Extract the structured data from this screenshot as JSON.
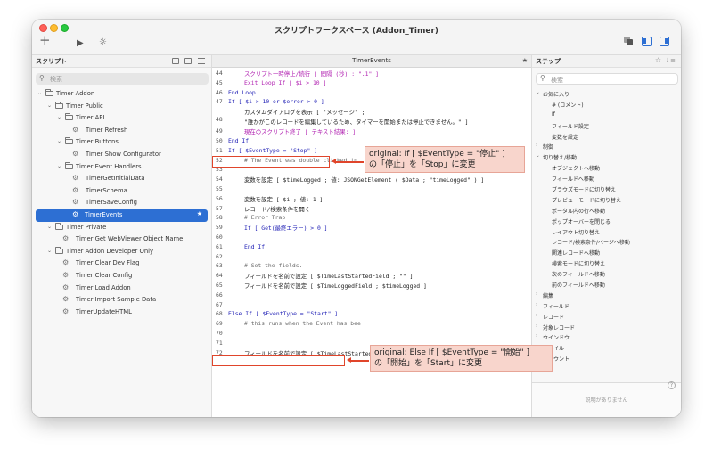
{
  "window": {
    "title": "スクリプトワークスペース (Addon_Timer)"
  },
  "toolbar": {
    "new_icon": "+",
    "run_icon": "▶",
    "debug_icon": "☼"
  },
  "left_panel": {
    "title": "スクリプト",
    "search_placeholder": "検索",
    "tree": [
      {
        "label": "Timer Addon",
        "type": "folder",
        "level": 0
      },
      {
        "label": "Timer Public",
        "type": "folder",
        "level": 1
      },
      {
        "label": "Timer API",
        "type": "folder",
        "level": 2
      },
      {
        "label": "Timer Refresh",
        "type": "script",
        "level": 3
      },
      {
        "label": "Timer Buttons",
        "type": "folder",
        "level": 2
      },
      {
        "label": "Timer Show Configurator",
        "type": "script",
        "level": 3
      },
      {
        "label": "Timer Event Handlers",
        "type": "folder",
        "level": 2
      },
      {
        "label": "TimerGetInitialData",
        "type": "script",
        "level": 3
      },
      {
        "label": "TimerSchema",
        "type": "script",
        "level": 3
      },
      {
        "label": "TimerSaveConfig",
        "type": "script",
        "level": 3
      },
      {
        "label": "TimerEvents",
        "type": "script",
        "level": 3,
        "selected": true
      },
      {
        "label": "Timer Private",
        "type": "folder",
        "level": 1
      },
      {
        "label": "Timer Get WebViewer Object Name",
        "type": "script",
        "level": 2
      },
      {
        "label": "Timer Addon Developer Only",
        "type": "folder",
        "level": 1
      },
      {
        "label": "Timer Clear Dev Flag",
        "type": "script",
        "level": 2
      },
      {
        "label": "Timer Clear Config",
        "type": "script",
        "level": 2
      },
      {
        "label": "Timer Load Addon",
        "type": "script",
        "level": 2
      },
      {
        "label": "Timer Import Sample Data",
        "type": "script",
        "level": 2
      },
      {
        "label": "TimerUpdateHTML",
        "type": "script",
        "level": 2
      }
    ]
  },
  "editor": {
    "tab_title": "TimerEvents",
    "lines": [
      {
        "n": "44",
        "indent": 2,
        "cls": "m",
        "text": "スクリプト一時停止/続行 [ 間隔 (秒) : \".1\" ]"
      },
      {
        "n": "45",
        "indent": 2,
        "cls": "m",
        "text": "Exit Loop If [ $i > 10 ]"
      },
      {
        "n": "46",
        "indent": 0,
        "cls": "k",
        "text": "End Loop"
      },
      {
        "n": "47",
        "indent": 0,
        "cls": "k",
        "text": "If [ $i > 10 or  $error > 0 ]"
      },
      {
        "n": "48",
        "indent": 2,
        "cls": "t",
        "text": "カスタムダイアログを表示 [ \"メッセージ\" ;",
        "text2": "\"誰かがこのレコードを編集しているため、タイマーを開始または停止できません。\" ]"
      },
      {
        "n": "49",
        "indent": 2,
        "cls": "m",
        "text": "現在のスクリプト終了 [ テキスト結果: ]"
      },
      {
        "n": "50",
        "indent": 0,
        "cls": "k",
        "text": "End If"
      },
      {
        "n": "51",
        "indent": 0,
        "cls": "k",
        "text": "If [ $EventType = \"Stop\" ]"
      },
      {
        "n": "52",
        "indent": 2,
        "cls": "c",
        "text": "# The Event was double clicked in"
      },
      {
        "n": "53",
        "indent": 0,
        "cls": "t",
        "text": ""
      },
      {
        "n": "54",
        "indent": 2,
        "cls": "t",
        "text": "変数を設定 [ $timeLogged ; 値: JSONGetElement ( $Data ; \"timeLogged\" ) ]"
      },
      {
        "n": "55",
        "indent": 0,
        "cls": "t",
        "text": ""
      },
      {
        "n": "56",
        "indent": 2,
        "cls": "t",
        "text": "変数を設定 [ $i ; 値: 1 ]"
      },
      {
        "n": "57",
        "indent": 2,
        "cls": "t",
        "text": "レコード/検索条件を開く"
      },
      {
        "n": "58",
        "indent": 2,
        "cls": "c",
        "text": "# Error Trap"
      },
      {
        "n": "59",
        "indent": 2,
        "cls": "k",
        "text": "If [ Get(最終エラー) > 0 ]"
      },
      {
        "n": "60",
        "indent": 0,
        "cls": "t",
        "text": ""
      },
      {
        "n": "61",
        "indent": 2,
        "cls": "k",
        "text": "End If"
      },
      {
        "n": "62",
        "indent": 0,
        "cls": "t",
        "text": ""
      },
      {
        "n": "63",
        "indent": 2,
        "cls": "c",
        "text": "# Set the fields."
      },
      {
        "n": "64",
        "indent": 2,
        "cls": "t",
        "text": "フィールドを名前で設定 [ $TimeLastStartedField ; \"\" ]"
      },
      {
        "n": "65",
        "indent": 2,
        "cls": "t",
        "text": "フィールドを名前で設定 [ $TimeLoggedField ; $timeLogged ]"
      },
      {
        "n": "66",
        "indent": 0,
        "cls": "t",
        "text": ""
      },
      {
        "n": "67",
        "indent": 0,
        "cls": "t",
        "text": ""
      },
      {
        "n": "68",
        "indent": 0,
        "cls": "k",
        "text": "Else If [ $EventType = \"Start\" ]"
      },
      {
        "n": "69",
        "indent": 2,
        "cls": "c",
        "text": "# this runs when the Event has bee"
      },
      {
        "n": "70",
        "indent": 0,
        "cls": "t",
        "text": ""
      },
      {
        "n": "71",
        "indent": 0,
        "cls": "t",
        "text": ""
      },
      {
        "n": "72",
        "indent": 2,
        "cls": "t",
        "text": "フィールドを名前で設定 [ $TimeLastStartedField ; Get(現在の時刻 UTC ミリ秒) ]"
      }
    ]
  },
  "annotations": {
    "note1_line1": "original: If [ $EventType = \"停止\" ]",
    "note1_line2": "の「停止」を「Stop」に変更",
    "note2_line1": "original: Else If [ $EventType = \"開始\" ]",
    "note2_line2": "の「開始」を「Start」に変更"
  },
  "right_panel": {
    "title": "ステップ",
    "search_placeholder": "検索",
    "steps": [
      {
        "label": "お気に入り",
        "group": true,
        "open": true,
        "level": 0
      },
      {
        "label": "# (コメント)",
        "level": 1
      },
      {
        "label": "If",
        "level": 1
      },
      {
        "label": "フィールド設定",
        "level": 1
      },
      {
        "label": "変数を設定",
        "level": 1
      },
      {
        "label": "制御",
        "group": true,
        "open": false,
        "level": 0
      },
      {
        "label": "切り替え/移動",
        "group": true,
        "open": true,
        "level": 0
      },
      {
        "label": "オブジェクトへ移動",
        "level": 1
      },
      {
        "label": "フィールドへ移動",
        "level": 1
      },
      {
        "label": "ブラウズモードに切り替え",
        "level": 1
      },
      {
        "label": "プレビューモードに切り替え",
        "level": 1
      },
      {
        "label": "ポータル内の行へ移動",
        "level": 1
      },
      {
        "label": "ポップオーバーを閉じる",
        "level": 1
      },
      {
        "label": "レイアウト切り替え",
        "level": 1
      },
      {
        "label": "レコード/検索条件/ページへ移動",
        "level": 1
      },
      {
        "label": "関連レコードへ移動",
        "level": 1
      },
      {
        "label": "検索モードに切り替え",
        "level": 1
      },
      {
        "label": "次のフィールドへ移動",
        "level": 1
      },
      {
        "label": "前のフィールドへ移動",
        "level": 1
      },
      {
        "label": "編集",
        "group": true,
        "open": false,
        "level": 0
      },
      {
        "label": "フィールド",
        "group": true,
        "open": false,
        "level": 0
      },
      {
        "label": "レコード",
        "group": true,
        "open": false,
        "level": 0
      },
      {
        "label": "対象レコード",
        "group": true,
        "open": false,
        "level": 0
      },
      {
        "label": "ウインドウ",
        "group": true,
        "open": false,
        "level": 0
      },
      {
        "label": "ファイル",
        "group": true,
        "open": false,
        "level": 0
      },
      {
        "label": "アカウント",
        "group": true,
        "open": false,
        "level": 0
      }
    ],
    "description_empty": "説明がありません",
    "help_icon": "?"
  }
}
